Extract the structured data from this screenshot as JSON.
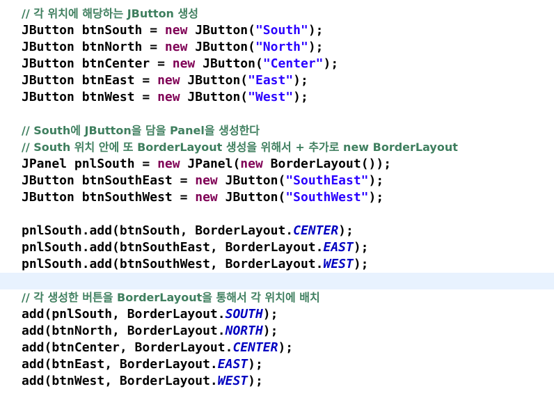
{
  "editor": {
    "colors": {
      "keyword": "#7f0055",
      "string": "#2a00ff",
      "static_field": "#0000c0",
      "comment": "#3f7f5f",
      "plain": "#000000",
      "current_line": "#e8f2fe",
      "background": "#ffffff"
    },
    "lines": [
      {
        "tokens": [
          {
            "t": "comment",
            "v": "// 각 위치에 해당하는 JButton 생성"
          }
        ]
      },
      {
        "tokens": [
          {
            "t": "plain",
            "v": "JButton btnSouth = "
          },
          {
            "t": "kw",
            "v": "new"
          },
          {
            "t": "plain",
            "v": " JButton("
          },
          {
            "t": "str",
            "v": "\"South\""
          },
          {
            "t": "plain",
            "v": ");"
          }
        ]
      },
      {
        "tokens": [
          {
            "t": "plain",
            "v": "JButton btnNorth = "
          },
          {
            "t": "kw",
            "v": "new"
          },
          {
            "t": "plain",
            "v": " JButton("
          },
          {
            "t": "str",
            "v": "\"North\""
          },
          {
            "t": "plain",
            "v": ");"
          }
        ]
      },
      {
        "tokens": [
          {
            "t": "plain",
            "v": "JButton btnCenter = "
          },
          {
            "t": "kw",
            "v": "new"
          },
          {
            "t": "plain",
            "v": " JButton("
          },
          {
            "t": "str",
            "v": "\"Center\""
          },
          {
            "t": "plain",
            "v": ");"
          }
        ]
      },
      {
        "tokens": [
          {
            "t": "plain",
            "v": "JButton btnEast = "
          },
          {
            "t": "kw",
            "v": "new"
          },
          {
            "t": "plain",
            "v": " JButton("
          },
          {
            "t": "str",
            "v": "\"East\""
          },
          {
            "t": "plain",
            "v": ");"
          }
        ]
      },
      {
        "tokens": [
          {
            "t": "plain",
            "v": "JButton btnWest = "
          },
          {
            "t": "kw",
            "v": "new"
          },
          {
            "t": "plain",
            "v": " JButton("
          },
          {
            "t": "str",
            "v": "\"West\""
          },
          {
            "t": "plain",
            "v": ");"
          }
        ]
      },
      {
        "tokens": []
      },
      {
        "tokens": [
          {
            "t": "comment",
            "v": "// South에 JButton을 담을 Panel을 생성한다"
          }
        ]
      },
      {
        "tokens": [
          {
            "t": "comment",
            "v": "// South 위치 안에 또 BorderLayout 생성을 위해서 + 추가로 new BorderLayout"
          }
        ]
      },
      {
        "tokens": [
          {
            "t": "plain",
            "v": "JPanel pnlSouth = "
          },
          {
            "t": "kw",
            "v": "new"
          },
          {
            "t": "plain",
            "v": " JPanel("
          },
          {
            "t": "kw",
            "v": "new"
          },
          {
            "t": "plain",
            "v": " BorderLayout());"
          }
        ]
      },
      {
        "tokens": [
          {
            "t": "plain",
            "v": "JButton btnSouthEast = "
          },
          {
            "t": "kw",
            "v": "new"
          },
          {
            "t": "plain",
            "v": " JButton("
          },
          {
            "t": "str",
            "v": "\"SouthEast\""
          },
          {
            "t": "plain",
            "v": ");"
          }
        ]
      },
      {
        "tokens": [
          {
            "t": "plain",
            "v": "JButton btnSouthWest = "
          },
          {
            "t": "kw",
            "v": "new"
          },
          {
            "t": "plain",
            "v": " JButton("
          },
          {
            "t": "str",
            "v": "\"SouthWest\""
          },
          {
            "t": "plain",
            "v": ");"
          }
        ]
      },
      {
        "tokens": []
      },
      {
        "tokens": [
          {
            "t": "plain",
            "v": "pnlSouth.add(btnSouth, BorderLayout."
          },
          {
            "t": "static",
            "v": "CENTER"
          },
          {
            "t": "plain",
            "v": ");"
          }
        ]
      },
      {
        "tokens": [
          {
            "t": "plain",
            "v": "pnlSouth.add(btnSouthEast, BorderLayout."
          },
          {
            "t": "static",
            "v": "EAST"
          },
          {
            "t": "plain",
            "v": ");"
          }
        ]
      },
      {
        "tokens": [
          {
            "t": "plain",
            "v": "pnlSouth.add(btnSouthWest, BorderLayout."
          },
          {
            "t": "static",
            "v": "WEST"
          },
          {
            "t": "plain",
            "v": ");"
          }
        ]
      },
      {
        "tokens": [],
        "current": true
      },
      {
        "tokens": [
          {
            "t": "comment",
            "v": "// 각 생성한 버튼을 BorderLayout을 통해서 각 위치에 배치"
          }
        ]
      },
      {
        "tokens": [
          {
            "t": "plain",
            "v": "add(pnlSouth, BorderLayout."
          },
          {
            "t": "static",
            "v": "SOUTH"
          },
          {
            "t": "plain",
            "v": ");"
          }
        ]
      },
      {
        "tokens": [
          {
            "t": "plain",
            "v": "add(btnNorth, BorderLayout."
          },
          {
            "t": "static",
            "v": "NORTH"
          },
          {
            "t": "plain",
            "v": ");"
          }
        ]
      },
      {
        "tokens": [
          {
            "t": "plain",
            "v": "add(btnCenter, BorderLayout."
          },
          {
            "t": "static",
            "v": "CENTER"
          },
          {
            "t": "plain",
            "v": ");"
          }
        ]
      },
      {
        "tokens": [
          {
            "t": "plain",
            "v": "add(btnEast, BorderLayout."
          },
          {
            "t": "static",
            "v": "EAST"
          },
          {
            "t": "plain",
            "v": ");"
          }
        ]
      },
      {
        "tokens": [
          {
            "t": "plain",
            "v": "add(btnWest, BorderLayout."
          },
          {
            "t": "static",
            "v": "WEST"
          },
          {
            "t": "plain",
            "v": ");"
          }
        ]
      }
    ]
  }
}
